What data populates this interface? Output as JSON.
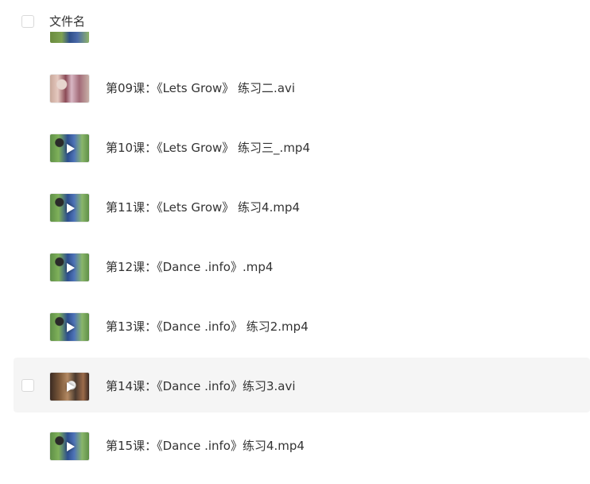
{
  "header": {
    "column_label": "文件名"
  },
  "files": [
    {
      "name": "第09课：《Lets  Grow》 练习二.avi",
      "thumb": "scene-a",
      "video": false
    },
    {
      "name": "第10课：《Lets  Grow》 练习三_.mp4",
      "thumb": "scene-b",
      "video": true
    },
    {
      "name": "第11课：《Lets  Grow》 练习4.mp4",
      "thumb": "scene-b",
      "video": true
    },
    {
      "name": "第12课：《Dance  .info》.mp4",
      "thumb": "scene-b",
      "video": true
    },
    {
      "name": "第13课：《Dance  .info》 练习2.mp4",
      "thumb": "scene-b",
      "video": true
    },
    {
      "name": "第14课：《Dance  .info》练习3.avi",
      "thumb": "scene-c",
      "video": true
    },
    {
      "name": "第15课：《Dance  .info》练习4.mp4",
      "thumb": "scene-b",
      "video": true
    }
  ],
  "hovered_row": 5,
  "colors": {
    "hover_bg": "#f5f5f5",
    "text": "#333333",
    "checkbox_border": "#d9d9d9"
  }
}
